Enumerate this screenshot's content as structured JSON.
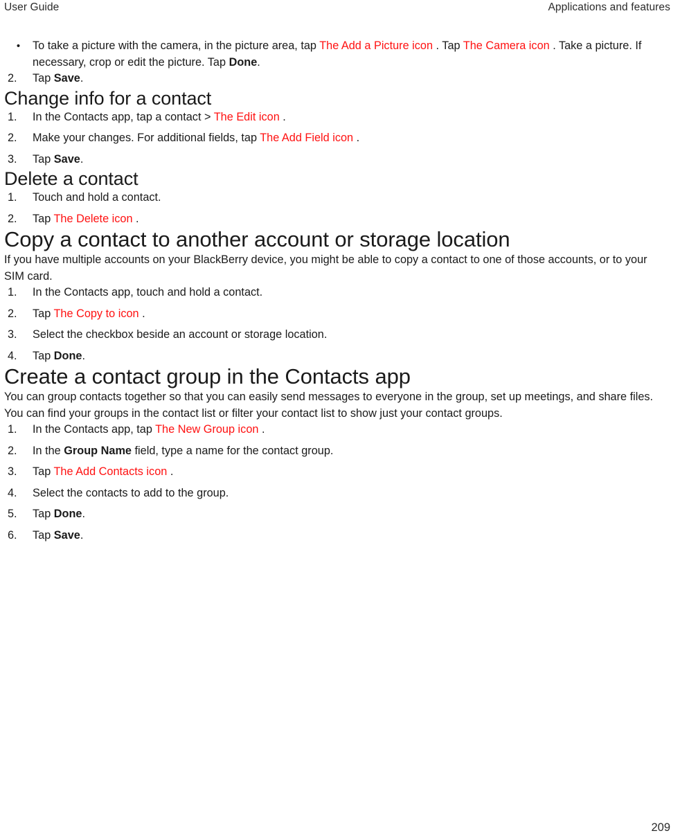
{
  "header": {
    "left": "User Guide",
    "right": "Applications and features"
  },
  "footer": {
    "page_number": "209"
  },
  "colors": {
    "icon_reference_red": "#ff1111",
    "body_text": "#1a1a1a",
    "background": "#ffffff"
  },
  "top_list": {
    "bullet": {
      "marker": "•",
      "part1": "To take a picture with the camera, in the picture area, tap ",
      "icon1": "The Add a Picture icon",
      "part2": " . Tap ",
      "icon2": "The Camera icon",
      "part3": " . Take a picture. If necessary, crop or edit the picture. Tap ",
      "bold1": "Done",
      "part4": "."
    },
    "step2": {
      "marker": "2.",
      "part1": "Tap ",
      "bold1": "Save",
      "part2": "."
    }
  },
  "sections": [
    {
      "id": "change-info",
      "heading": "Change info for a contact",
      "heading_level": "h2",
      "steps": [
        {
          "marker": "1.",
          "part1": "In the Contacts app, tap a contact > ",
          "icon1": "The Edit icon",
          "part2": " ."
        },
        {
          "marker": "2.",
          "part1": "Make your changes. For additional fields, tap ",
          "icon1": "The Add Field icon",
          "part2": " ."
        },
        {
          "marker": "3.",
          "part1": "Tap ",
          "bold1": "Save",
          "part2": "."
        }
      ]
    },
    {
      "id": "delete-contact",
      "heading": "Delete a contact",
      "heading_level": "h2",
      "steps": [
        {
          "marker": "1.",
          "part1": "Touch and hold a contact."
        },
        {
          "marker": "2.",
          "part1": "Tap ",
          "icon1": "The Delete icon",
          "part2": " ."
        }
      ]
    },
    {
      "id": "copy-contact",
      "heading": "Copy a contact to another account or storage location",
      "heading_level": "h1",
      "paragraph": "If you have multiple accounts on your BlackBerry device, you might be able to copy a contact to one of those accounts, or to your SIM card.",
      "steps": [
        {
          "marker": "1.",
          "part1": "In the Contacts app, touch and hold a contact."
        },
        {
          "marker": "2.",
          "part1": "Tap ",
          "icon1": "The Copy to icon",
          "part2": " ."
        },
        {
          "marker": "3.",
          "part1": "Select the checkbox beside an account or storage location."
        },
        {
          "marker": "4.",
          "part1": "Tap ",
          "bold1": "Done",
          "part2": "."
        }
      ]
    },
    {
      "id": "create-group",
      "heading": "Create a contact group in the Contacts app",
      "heading_level": "h1",
      "paragraph": "You can group contacts together so that you can easily send messages to everyone in the group, set up meetings, and share files. You can find your groups in the contact list or filter your contact list to show just your contact groups.",
      "steps": [
        {
          "marker": "1.",
          "part1": "In the Contacts app, tap ",
          "icon1": "The New Group icon",
          "part2": " ."
        },
        {
          "marker": "2.",
          "part1": "In the ",
          "bold1": "Group Name",
          "part2": " field, type a name for the contact group."
        },
        {
          "marker": "3.",
          "part1": "Tap ",
          "icon1": "The Add Contacts icon",
          "part2": " ."
        },
        {
          "marker": "4.",
          "part1": "Select the contacts to add to the group."
        },
        {
          "marker": "5.",
          "part1": "Tap ",
          "bold1": "Done",
          "part2": "."
        },
        {
          "marker": "6.",
          "part1": "Tap ",
          "bold1": "Save",
          "part2": "."
        }
      ]
    }
  ]
}
